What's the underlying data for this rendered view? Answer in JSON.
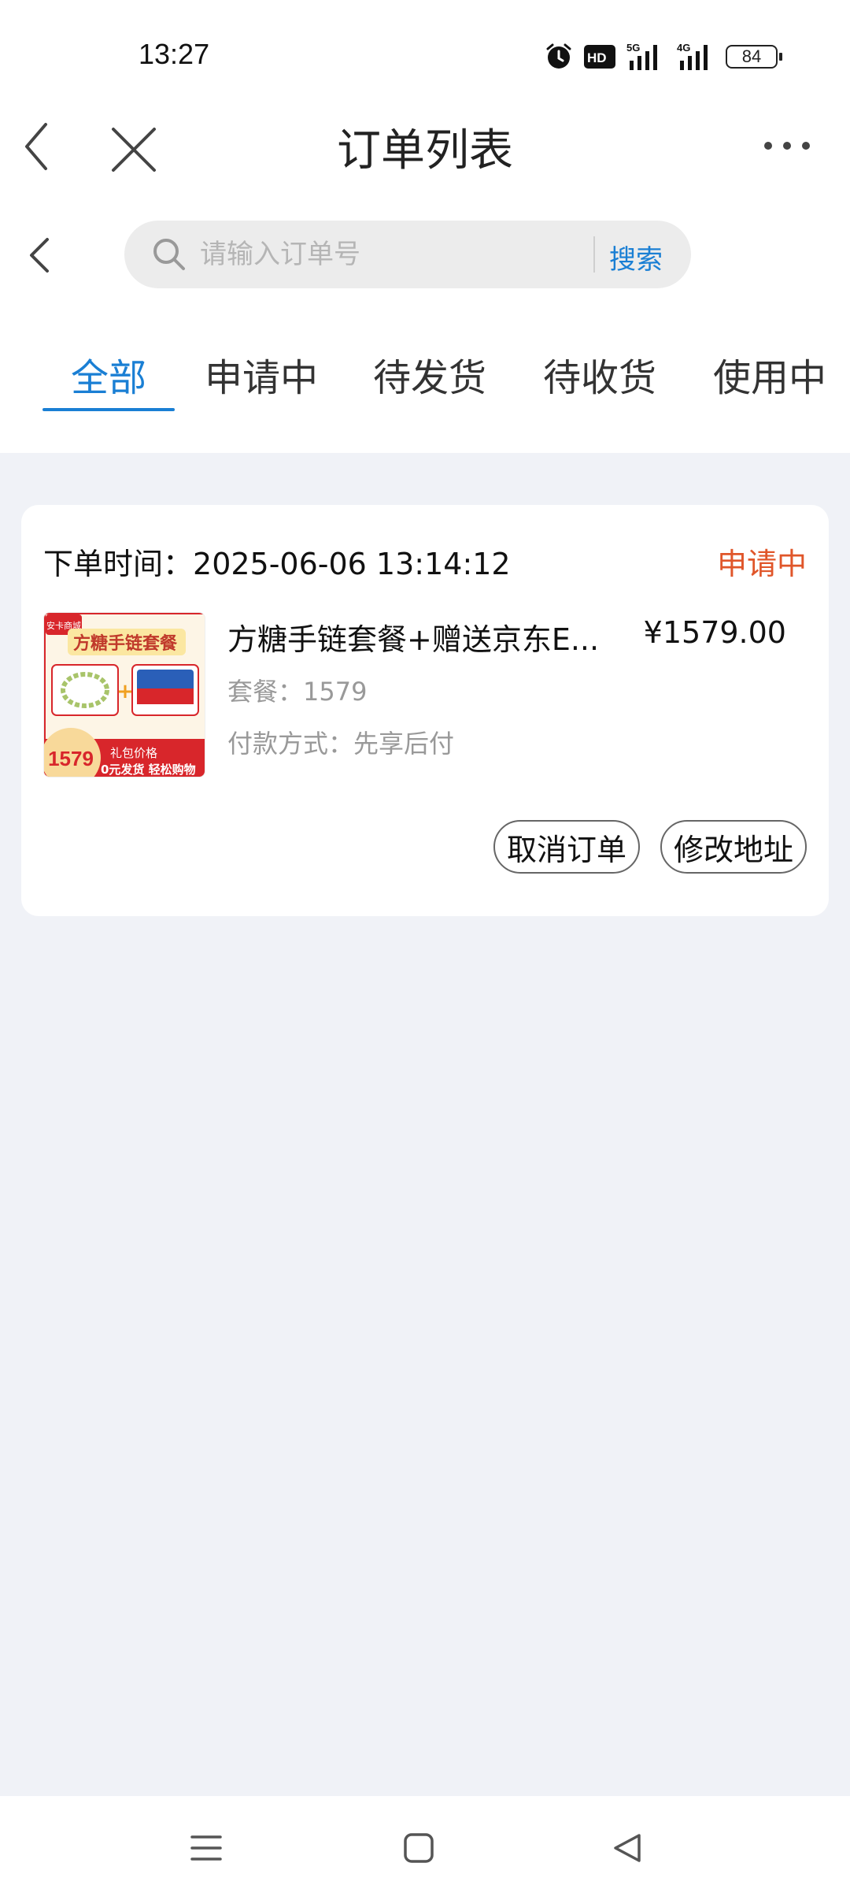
{
  "status_bar": {
    "time": "13:27",
    "icons": [
      "alarm-icon",
      "hd-icon",
      "5g-signal-icon",
      "4g-signal-icon"
    ],
    "battery": "84"
  },
  "nav": {
    "title": "订单列表"
  },
  "search": {
    "placeholder": "请输入订单号",
    "value": "",
    "button_label": "搜索"
  },
  "tabs": [
    {
      "label": "全部",
      "active": true
    },
    {
      "label": "申请中",
      "active": false
    },
    {
      "label": "待发货",
      "active": false
    },
    {
      "label": "待收货",
      "active": false
    },
    {
      "label": "使用中",
      "active": false
    }
  ],
  "order": {
    "time_label": "下单时间：",
    "time_value": "2025-06-06 13:14:12",
    "status": "申请中",
    "product_name": "方糖手链套餐+赠送京东E...",
    "price": "¥1579.00",
    "package_label": "套餐：",
    "package_value": "1579",
    "payment_label": "付款方式：",
    "payment_value": "先享后付",
    "cancel_label": "取消订单",
    "address_label": "修改地址",
    "thumb": {
      "banner": "方糖手链套餐",
      "badge": "1579",
      "logo": "安卡商城",
      "strip1": "礼包价格",
      "strip2": "0元发货 轻松购物"
    }
  },
  "colors": {
    "accent": "#1a7fd4",
    "status": "#e0562a",
    "background": "#f0f2f7"
  }
}
